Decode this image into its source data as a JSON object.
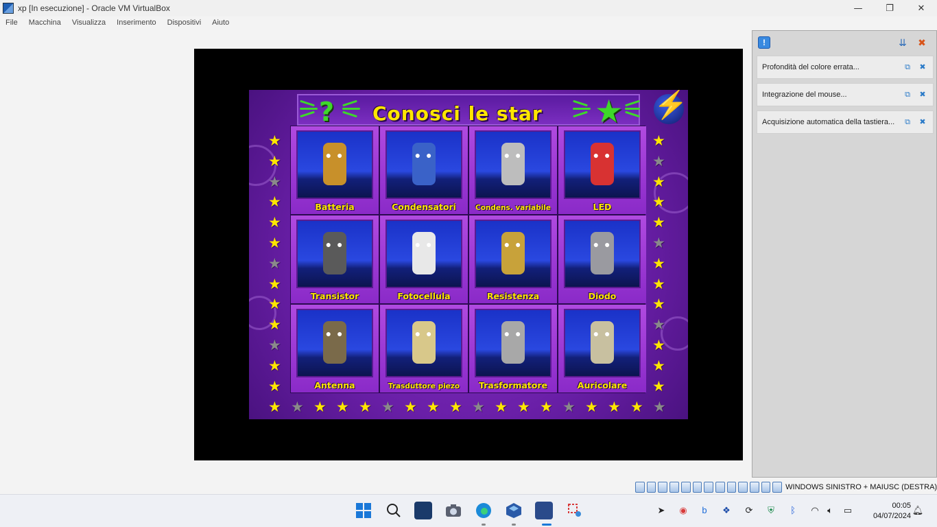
{
  "window": {
    "title": "xp [In esecuzione] - Oracle VM VirtualBox",
    "controls": {
      "minimize": "—",
      "restore": "❐",
      "close": "✕"
    }
  },
  "menu": [
    "File",
    "Macchina",
    "Visualizza",
    "Inserimento",
    "Dispositivi",
    "Aiuto"
  ],
  "game": {
    "title": "Conosci le star",
    "question_mark": "?",
    "tiles": [
      {
        "label": "Batteria",
        "color": "#c8902a"
      },
      {
        "label": "Condensatori",
        "color": "#3a62c8"
      },
      {
        "label": "Condens. variabile",
        "color": "#bdbdbd",
        "small": true
      },
      {
        "label": "LED",
        "color": "#d83232"
      },
      {
        "label": "Transistor",
        "color": "#5a5a5a"
      },
      {
        "label": "Fotocellula",
        "color": "#e8e8e8"
      },
      {
        "label": "Resistenza",
        "color": "#c8a23a"
      },
      {
        "label": "Diodo",
        "color": "#9a9aa0"
      },
      {
        "label": "Antenna",
        "color": "#7a6a4a"
      },
      {
        "label": "Trasduttore piezo",
        "color": "#d8c88a",
        "small": true
      },
      {
        "label": "Trasformatore",
        "color": "#a8a8a8"
      },
      {
        "label": "Auricolare",
        "color": "#c8c0a0"
      }
    ],
    "left_stars": [
      "on",
      "on",
      "off",
      "on",
      "on",
      "on",
      "off",
      "on",
      "on",
      "on",
      "off",
      "on",
      "on"
    ],
    "right_stars": [
      "on",
      "off",
      "on",
      "on",
      "on",
      "off",
      "on",
      "on",
      "on",
      "off",
      "on",
      "on",
      "on"
    ],
    "bottom_stars": [
      "on",
      "off",
      "on",
      "on",
      "on",
      "off",
      "on",
      "on",
      "on",
      "off",
      "on",
      "on",
      "on",
      "off",
      "on",
      "on",
      "on",
      "off"
    ]
  },
  "notifications": {
    "header_info_icon": "!",
    "items": [
      {
        "text": "Profondità del colore errata..."
      },
      {
        "text": "Integrazione del mouse..."
      },
      {
        "text": "Acquisizione automatica della tastiera..."
      }
    ]
  },
  "statusbar": {
    "host_key": "WINDOWS SINISTRO + MAIUSC (DESTRA)"
  },
  "taskbar": {
    "time": "00:05",
    "date": "04/07/2024"
  }
}
